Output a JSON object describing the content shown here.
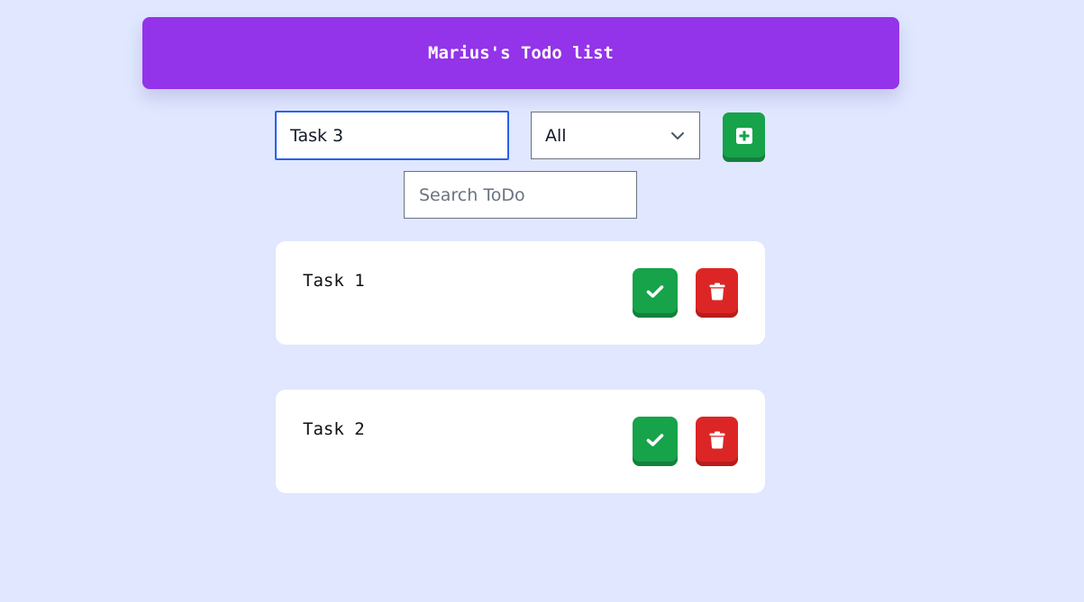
{
  "header": {
    "title": "Marius's Todo list"
  },
  "form": {
    "task_input_value": "Task 3",
    "filter_selected": "All",
    "add_icon": "plus-square-icon"
  },
  "search": {
    "placeholder": "Search ToDo"
  },
  "todos": [
    {
      "text": "Task 1",
      "complete_icon": "check-icon",
      "delete_icon": "trash-icon"
    },
    {
      "text": "Task 2",
      "complete_icon": "check-icon",
      "delete_icon": "trash-icon"
    }
  ],
  "colors": {
    "background": "#e0e7ff",
    "header": "#9333ea",
    "success": "#16a34a",
    "danger": "#dc2626",
    "focus_border": "#2563eb"
  }
}
